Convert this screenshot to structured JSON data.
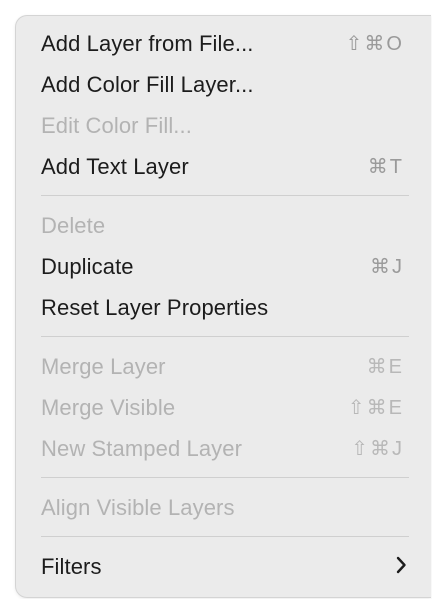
{
  "menu": {
    "items": [
      {
        "label": "Add Layer from File...",
        "shortcut": "⇧⌘O"
      },
      {
        "label": "Add Color Fill Layer...",
        "shortcut": ""
      },
      {
        "label": "Edit Color Fill...",
        "shortcut": ""
      },
      {
        "label": "Add Text Layer",
        "shortcut": "⌘T"
      },
      {
        "label": "Delete",
        "shortcut": ""
      },
      {
        "label": "Duplicate",
        "shortcut": "⌘J"
      },
      {
        "label": "Reset Layer Properties",
        "shortcut": ""
      },
      {
        "label": "Merge Layer",
        "shortcut": "⌘E"
      },
      {
        "label": "Merge Visible",
        "shortcut": "⇧⌘E"
      },
      {
        "label": "New Stamped Layer",
        "shortcut": "⇧⌘J"
      },
      {
        "label": "Align Visible Layers",
        "shortcut": ""
      },
      {
        "label": "Filters",
        "submenu_icon": "chevron-right-icon"
      }
    ]
  },
  "colors": {
    "menu_background": "#ebebeb",
    "enabled_text": "#1c1c1c",
    "disabled_text": "#b3b3b3",
    "shortcut_text": "#9a9a9a",
    "separator": "#cfcfcf"
  }
}
